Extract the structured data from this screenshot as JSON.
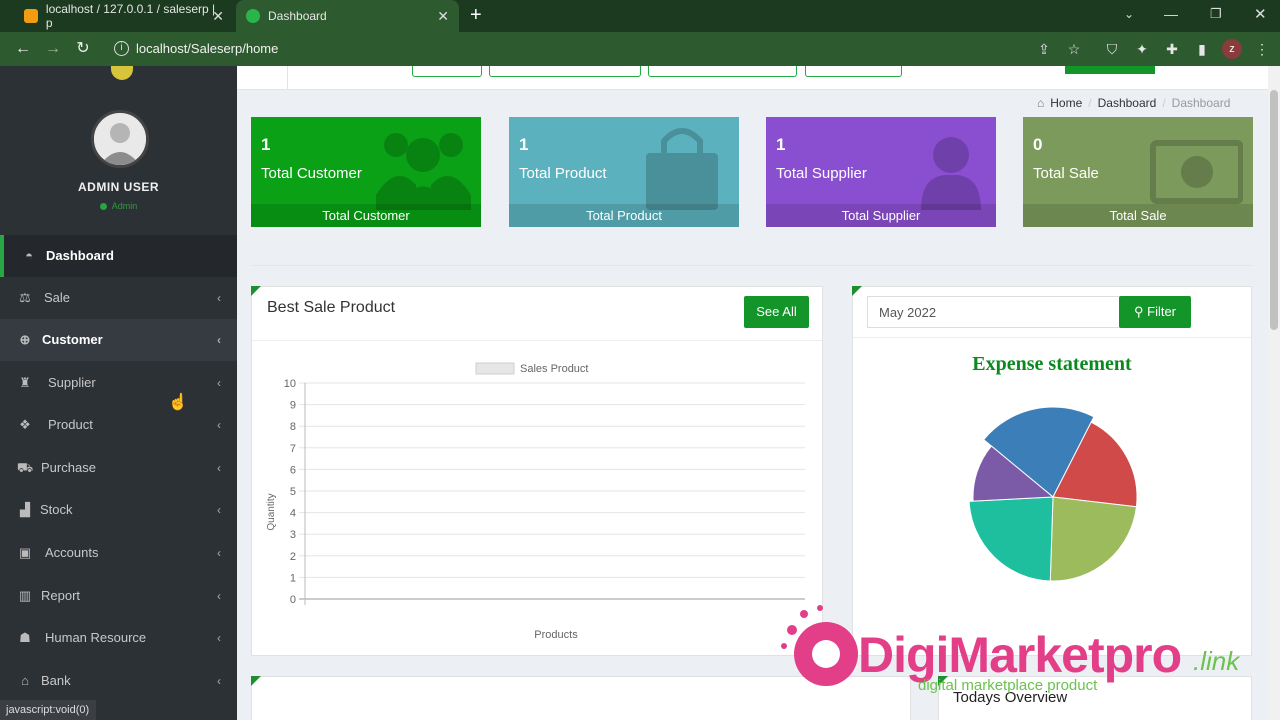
{
  "browser": {
    "tabs": [
      {
        "title": "localhost / 127.0.0.1 / saleserp | p"
      },
      {
        "title": "Dashboard"
      }
    ],
    "url": "localhost/Saleserp/home",
    "profile_initial": "z",
    "status_text": "javascript:void(0)"
  },
  "sidebar": {
    "user_name": "ADMIN USER",
    "user_role": "Admin",
    "items": [
      {
        "label": "Dashboard",
        "icon": "dashboard-icon"
      },
      {
        "label": "Sale",
        "icon": "balance-scale-icon"
      },
      {
        "label": "Customer",
        "icon": "handshake-icon"
      },
      {
        "label": "Supplier",
        "icon": "supplier-icon"
      },
      {
        "label": "Product",
        "icon": "cubes-icon"
      },
      {
        "label": "Purchase",
        "icon": "cart-icon"
      },
      {
        "label": "Stock",
        "icon": "bar-chart-icon"
      },
      {
        "label": "Accounts",
        "icon": "money-icon"
      },
      {
        "label": "Report",
        "icon": "book-icon"
      },
      {
        "label": "Human Resource",
        "icon": "users-icon"
      },
      {
        "label": "Bank",
        "icon": "bank-icon"
      }
    ]
  },
  "breadcrumb": {
    "home": "Home",
    "section": "Dashboard",
    "current": "Dashboard"
  },
  "stats": [
    {
      "count": "1",
      "label": "Total Customer",
      "footer": "Total Customer",
      "color": "#0aa116"
    },
    {
      "count": "1",
      "label": "Total Product",
      "footer": "Total Product",
      "color": "#5bb1bd"
    },
    {
      "count": "1",
      "label": "Total Supplier",
      "footer": "Total Supplier",
      "color": "#8a4fd1"
    },
    {
      "count": "0",
      "label": "Total Sale",
      "footer": "Total Sale",
      "color": "#7c9a5b"
    }
  ],
  "best_sale": {
    "title": "Best Sale Product",
    "see_all": "See All"
  },
  "expense": {
    "month_value": "May 2022",
    "filter_label": "Filter",
    "title": "Expense statement"
  },
  "todays_overview": {
    "title": "Todays Overview"
  },
  "watermark": {
    "brand": "DigiMarketpro",
    "suffix": ".link",
    "tagline": "digital marketplace product"
  },
  "chart_data": [
    {
      "type": "bar",
      "title": "",
      "legend": [
        "Sales Product"
      ],
      "legend_position": "top",
      "xlabel": "Products",
      "ylabel": "Quantity",
      "ylim": [
        0,
        10
      ],
      "yticks": [
        "0",
        "1",
        "2",
        "3",
        "4",
        "5",
        "6",
        "7",
        "8",
        "9",
        "10"
      ],
      "categories": [],
      "series": [
        {
          "name": "Sales Product",
          "values": []
        }
      ],
      "grid": true
    },
    {
      "type": "pie",
      "title": "Expense statement",
      "slices": [
        {
          "value": 20,
          "color": "#3c7fb8"
        },
        {
          "value": 18,
          "color": "#d04a4a"
        },
        {
          "value": 22,
          "color": "#9bbb5c"
        },
        {
          "value": 22,
          "color": "#1ebf9f"
        },
        {
          "value": 11,
          "color": "#7b5aa8"
        }
      ]
    }
  ]
}
